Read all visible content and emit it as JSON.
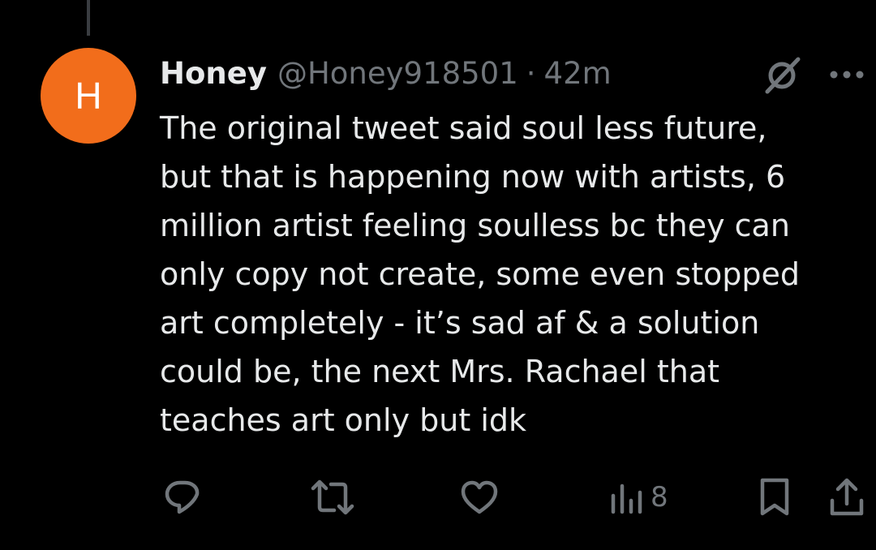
{
  "theme": {
    "background": "#000000",
    "text_primary": "#e7e9ea",
    "text_secondary": "#71767b",
    "avatar_color": "#f26d1b"
  },
  "tweet": {
    "avatar_letter": "H",
    "display_name": "Honey",
    "handle": "@Honey918501",
    "separator": "·",
    "time": "42m",
    "text": "The original tweet said soul less future,\nbut that is happening now with artists, 6\nmillion artist feeling soulless bc they can\nonly copy not create, some even stopped\nart completely - it’s sad af & a solution\ncould be, the next Mrs. Rachael that\nteaches art only but idk"
  },
  "actions": {
    "reply_icon": "reply-icon",
    "retweet_icon": "retweet-icon",
    "like_icon": "heart-icon",
    "views_icon": "views-chart-icon",
    "views_count": "8",
    "bookmark_icon": "bookmark-icon",
    "share_icon": "share-icon"
  }
}
